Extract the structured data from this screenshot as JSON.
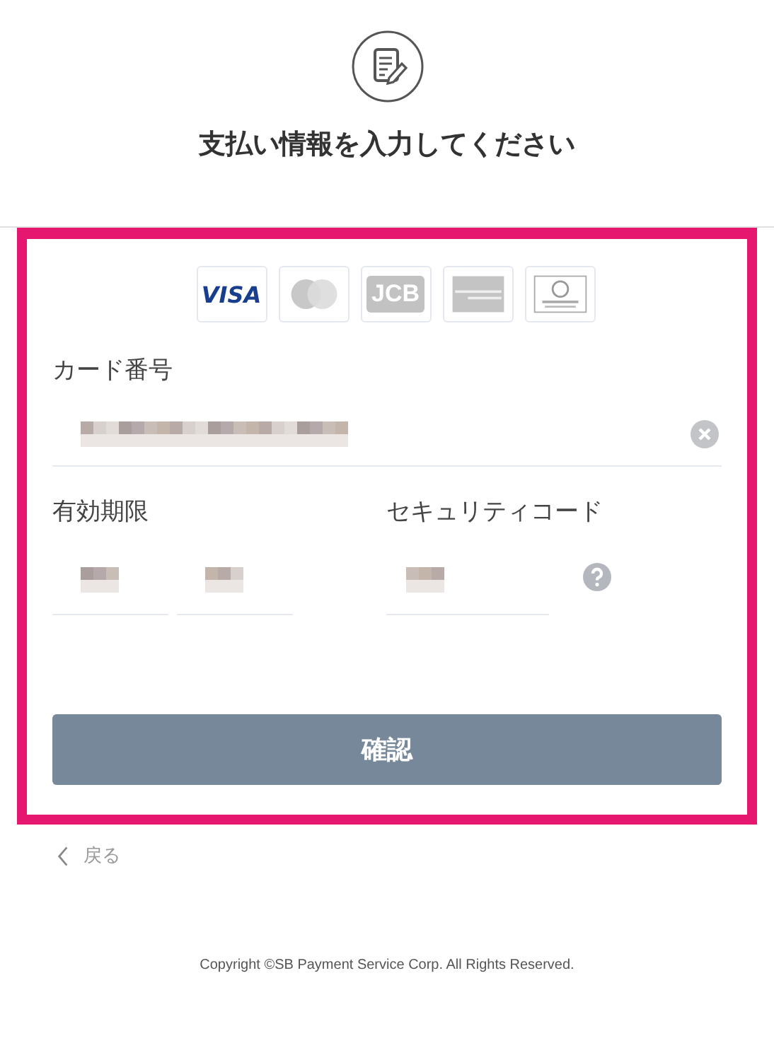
{
  "header": {
    "title": "支払い情報を入力してください"
  },
  "card_brands": [
    {
      "kind": "visa",
      "label": "VISA"
    },
    {
      "kind": "mastercard"
    },
    {
      "kind": "jcb",
      "label": "JCB"
    },
    {
      "kind": "amex"
    },
    {
      "kind": "diners"
    }
  ],
  "card_number": {
    "label": "カード番号"
  },
  "expiry": {
    "label": "有効期限"
  },
  "security_code": {
    "label": "セキュリティコード"
  },
  "confirm_button": {
    "label": "確認",
    "disabled": true
  },
  "back_link": {
    "label": "戻る"
  },
  "footer": {
    "copyright": "Copyright ©SB Payment Service Corp. All Rights Reserved."
  }
}
